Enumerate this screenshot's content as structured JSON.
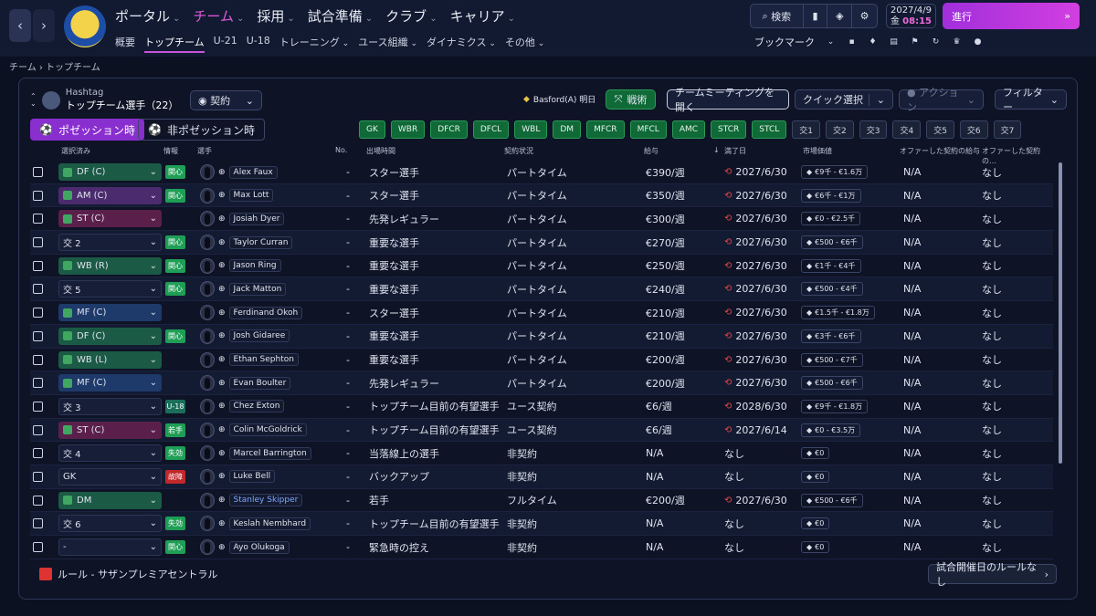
{
  "nav": {
    "main": [
      {
        "label": "ポータル",
        "active": false
      },
      {
        "label": "チーム",
        "active": true
      },
      {
        "label": "採用",
        "active": false
      },
      {
        "label": "試合準備",
        "active": false
      },
      {
        "label": "クラブ",
        "active": false
      },
      {
        "label": "キャリア",
        "active": false
      }
    ],
    "sub": [
      "概要",
      "トップチーム",
      "U-21",
      "U-18",
      "トレーニング",
      "ユース組織",
      "ダイナミクス",
      "その他"
    ],
    "sub_dropdowns": [
      false,
      false,
      false,
      false,
      true,
      true,
      true,
      true
    ],
    "search_label": "検索",
    "date_line1": "2027/4/9",
    "date_day": "金",
    "date_time": "08:15",
    "continue_label": "進行",
    "bookmarks_label": "ブックマーク",
    "breadcrumb": "チーム › トップチーム"
  },
  "panel": {
    "team_name": "Hashtag",
    "squad_title": "トップチーム選手（22）",
    "contract_select": "契約",
    "match_info": "Basford(A) 明日",
    "tactics_label": "戦術",
    "team_meeting_label": "チームミーティングを開く",
    "quick_select_label": "クイック選択",
    "action_label": "アクション",
    "filter_label": "フィルター",
    "tab_in_possession": "ポゼッション時",
    "tab_out_possession": "非ポゼッション時",
    "positions": [
      "GK",
      "WBR",
      "DFCR",
      "DFCL",
      "WBL",
      "DM",
      "MFCR",
      "MFCL",
      "AMC",
      "STCR",
      "STCL"
    ],
    "subs": [
      "交1",
      "交2",
      "交3",
      "交4",
      "交5",
      "交6",
      "交7"
    ],
    "columns": [
      "選択済み",
      "情報",
      "選手",
      "No.",
      "出場時間",
      "契約状況",
      "給与",
      "満了日",
      "市場価値",
      "オファーした契約の給与",
      "オファーした契約の…"
    ]
  },
  "accent": {
    "purple": "#a12fdb",
    "green": "#0f6a38",
    "red": "#e04848",
    "pink": "#f06ad9"
  },
  "rows": [
    {
      "sel": "DF (C)",
      "selColor": "#1b5a45",
      "info": "関心",
      "infoColor": "#1f9e55",
      "name": "Alex Faux",
      "no": "-",
      "time": "スター選手",
      "contract": "パートタイム",
      "wage": "€390/週",
      "expiry": "2027/6/30",
      "value": "€9千 - €1.6万",
      "offer": "N/A",
      "offer2": "なし"
    },
    {
      "sel": "AM (C)",
      "selColor": "#4b2a6e",
      "info": "関心",
      "infoColor": "#1f9e55",
      "name": "Max Lott",
      "no": "-",
      "time": "スター選手",
      "contract": "パートタイム",
      "wage": "€350/週",
      "expiry": "2027/6/30",
      "value": "€6千 - €1万",
      "offer": "N/A",
      "offer2": "なし"
    },
    {
      "sel": "ST (C)",
      "selColor": "#5a1f4a",
      "info": "",
      "infoColor": "",
      "name": "Josiah Dyer",
      "no": "-",
      "time": "先発レギュラー",
      "contract": "パートタイム",
      "wage": "€300/週",
      "expiry": "2027/6/30",
      "value": "€0 - €2.5千",
      "offer": "N/A",
      "offer2": "なし"
    },
    {
      "sel": "交 2",
      "selColor": "",
      "info": "関心",
      "infoColor": "#1f9e55",
      "name": "Taylor Curran",
      "no": "-",
      "time": "重要な選手",
      "contract": "パートタイム",
      "wage": "€270/週",
      "expiry": "2027/6/30",
      "value": "€500 - €6千",
      "offer": "N/A",
      "offer2": "なし"
    },
    {
      "sel": "WB (R)",
      "selColor": "#1b5a45",
      "info": "関心",
      "infoColor": "#1f9e55",
      "name": "Jason Ring",
      "no": "-",
      "time": "重要な選手",
      "contract": "パートタイム",
      "wage": "€250/週",
      "expiry": "2027/6/30",
      "value": "€1千 - €4千",
      "offer": "N/A",
      "offer2": "なし"
    },
    {
      "sel": "交 5",
      "selColor": "",
      "info": "関心",
      "infoColor": "#1f9e55",
      "name": "Jack Matton",
      "no": "-",
      "time": "重要な選手",
      "contract": "パートタイム",
      "wage": "€240/週",
      "expiry": "2027/6/30",
      "value": "€500 - €4千",
      "offer": "N/A",
      "offer2": "なし"
    },
    {
      "sel": "MF (C)",
      "selColor": "#1d3a6a",
      "info": "",
      "infoColor": "",
      "name": "Ferdinand Okoh",
      "no": "-",
      "time": "スター選手",
      "contract": "パートタイム",
      "wage": "€210/週",
      "expiry": "2027/6/30",
      "value": "€1.5千 - €1.8万",
      "offer": "N/A",
      "offer2": "なし"
    },
    {
      "sel": "DF (C)",
      "selColor": "#1b5a45",
      "info": "関心",
      "infoColor": "#1f9e55",
      "name": "Josh Gidaree",
      "no": "-",
      "time": "重要な選手",
      "contract": "パートタイム",
      "wage": "€210/週",
      "expiry": "2027/6/30",
      "value": "€3千 - €6千",
      "offer": "N/A",
      "offer2": "なし"
    },
    {
      "sel": "WB (L)",
      "selColor": "#1b5a45",
      "info": "",
      "infoColor": "",
      "name": "Ethan Sephton",
      "no": "-",
      "time": "重要な選手",
      "contract": "パートタイム",
      "wage": "€200/週",
      "expiry": "2027/6/30",
      "value": "€500 - €7千",
      "offer": "N/A",
      "offer2": "なし"
    },
    {
      "sel": "MF (C)",
      "selColor": "#1d3a6a",
      "info": "",
      "infoColor": "",
      "name": "Evan Boulter",
      "no": "-",
      "time": "先発レギュラー",
      "contract": "パートタイム",
      "wage": "€200/週",
      "expiry": "2027/6/30",
      "value": "€500 - €6千",
      "offer": "N/A",
      "offer2": "なし"
    },
    {
      "sel": "交 3",
      "selColor": "",
      "info": "U-18",
      "infoColor": "#1a6e5a",
      "name": "Chez Exton",
      "no": "-",
      "time": "トップチーム目前の有望選手",
      "contract": "ユース契約",
      "wage": "€6/週",
      "expiry": "2028/6/30",
      "value": "€9千 - €1.8万",
      "offer": "N/A",
      "offer2": "なし"
    },
    {
      "sel": "ST (C)",
      "selColor": "#5a1f4a",
      "info": "若手",
      "infoColor": "#1f9e55",
      "name": "Colin McGoldrick",
      "no": "-",
      "time": "トップチーム目前の有望選手",
      "contract": "ユース契約",
      "wage": "€6/週",
      "expiry": "2027/6/14",
      "value": "€0 - €3.5万",
      "offer": "N/A",
      "offer2": "なし"
    },
    {
      "sel": "交 4",
      "selColor": "",
      "info": "失効",
      "infoColor": "#1f9e55",
      "name": "Marcel Barrington",
      "no": "-",
      "time": "当落線上の選手",
      "contract": "非契約",
      "wage": "N/A",
      "expiry": "なし",
      "value": "€0",
      "offer": "N/A",
      "offer2": "なし"
    },
    {
      "sel": "GK",
      "selColor": "",
      "info": "故障",
      "infoColor": "#c0282a",
      "name": "Luke Bell",
      "no": "-",
      "time": "バックアップ",
      "contract": "非契約",
      "wage": "N/A",
      "expiry": "なし",
      "value": "€0",
      "offer": "N/A",
      "offer2": "なし"
    },
    {
      "sel": "DM",
      "selColor": "#1b5a45",
      "info": "",
      "infoColor": "",
      "name": "Stanley Skipper",
      "no": "-",
      "time": "若手",
      "contract": "フルタイム",
      "wage": "€200/週",
      "expiry": "2027/6/30",
      "value": "€500 - €6千",
      "offer": "N/A",
      "offer2": "なし"
    },
    {
      "sel": "交 6",
      "selColor": "",
      "info": "失効",
      "infoColor": "#1f9e55",
      "name": "Keslah Nembhard",
      "no": "-",
      "time": "トップチーム目前の有望選手",
      "contract": "非契約",
      "wage": "N/A",
      "expiry": "なし",
      "value": "€0",
      "offer": "N/A",
      "offer2": "なし"
    },
    {
      "sel": "-",
      "selColor": "",
      "info": "関心",
      "infoColor": "#1f9e55",
      "name": "Ayo Olukoga",
      "no": "-",
      "time": "緊急時の控え",
      "contract": "非契約",
      "wage": "N/A",
      "expiry": "なし",
      "value": "€0",
      "offer": "N/A",
      "offer2": "なし"
    }
  ],
  "footer": {
    "rule": "ルール - サザンプレミアセントラル",
    "no_matchday": "試合開催日のルールなし"
  }
}
